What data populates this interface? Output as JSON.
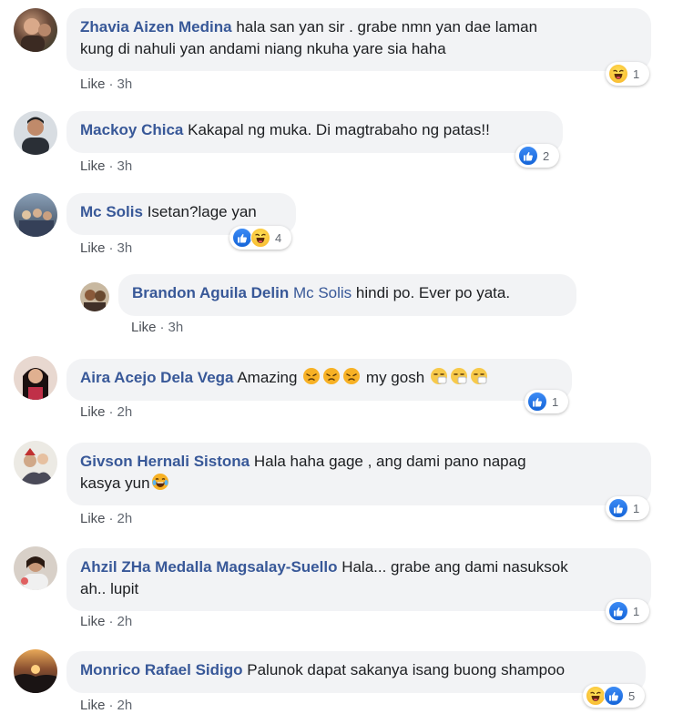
{
  "comments": [
    {
      "name": "Zhavia Aizen Medina",
      "text_line1": "hala san yan sir . grabe nmn yan dae laman",
      "text_line2": "kung di nahuli yan andami niang nkuha yare sia haha",
      "like": "Like",
      "time": "3h",
      "reactions": [
        "haha"
      ],
      "count": "1"
    },
    {
      "name": "Mackoy Chica",
      "text": "Kakapal ng muka. Di magtrabaho ng patas!!",
      "like": "Like",
      "time": "3h",
      "reactions": [
        "like"
      ],
      "count": "2"
    },
    {
      "name": "Mc Solis",
      "text": "Isetan?lage yan",
      "like": "Like",
      "time": "3h",
      "reactions": [
        "like",
        "haha"
      ],
      "count": "4"
    },
    {
      "name": "Brandon Aguila Delin",
      "mention": "Mc Solis",
      "text": "hindi po. Ever po yata.",
      "like": "Like",
      "time": "3h"
    },
    {
      "name": "Aira Acejo Dela Vega",
      "text_a": "Amazing",
      "text_b": "my gosh",
      "like": "Like",
      "time": "2h",
      "reactions": [
        "like"
      ],
      "count": "1"
    },
    {
      "name": "Givson Hernali Sistona",
      "text_line1": "Hala haha gage , ang dami pano napag",
      "text_line2": "kasya yun",
      "like": "Like",
      "time": "2h",
      "reactions": [
        "like"
      ],
      "count": "1"
    },
    {
      "name": "Ahzil ZHa Medalla Magsalay-Suello",
      "text_line1": "Hala... grabe ang dami nasuksok",
      "text_line2": "ah.. lupit",
      "like": "Like",
      "time": "2h",
      "reactions": [
        "like"
      ],
      "count": "1"
    },
    {
      "name": "Monrico Rafael Sidigo",
      "text": "Palunok dapat sakanya isang buong shampoo",
      "like": "Like",
      "time": "2h",
      "reactions": [
        "haha",
        "like"
      ],
      "count": "5"
    }
  ],
  "colors": {
    "name": "#385898",
    "bubble": "#f2f3f5",
    "meta": "#616770",
    "like_blue": "#1877f2"
  },
  "icons": {
    "like": "thumbs-up-icon",
    "haha": "laughing-face-icon",
    "angry": "persevering-face-icon",
    "sneeze": "sneezing-face-icon",
    "laugh_tears": "tears-of-joy-icon"
  }
}
